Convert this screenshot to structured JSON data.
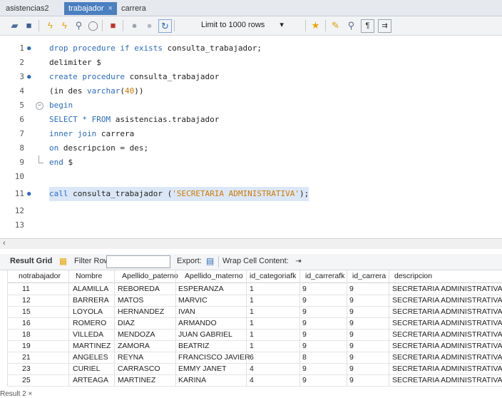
{
  "tabs": [
    {
      "label": "asistencias2",
      "active": false
    },
    {
      "label": "trabajador",
      "active": true,
      "closable": true
    },
    {
      "label": "carrera",
      "active": false
    }
  ],
  "toolbar": {
    "limit_label": "Limit to 1000 rows",
    "icons": [
      "folder-icon",
      "save-icon",
      "lightning-icon",
      "lightning-cursor-icon",
      "magnifier-icon",
      "stop-icon",
      "toggle-output-icon",
      "commit-icon",
      "rollback-icon",
      "autocommit-icon",
      "star-icon",
      "brush-icon",
      "search-icon",
      "invisible-chars-icon",
      "wrap-icon"
    ]
  },
  "editor": {
    "lines": [
      {
        "n": "1",
        "marker": true
      },
      {
        "n": "2"
      },
      {
        "n": "3",
        "marker": true
      },
      {
        "n": "4"
      },
      {
        "n": "5",
        "fold": true
      },
      {
        "n": "6"
      },
      {
        "n": "7"
      },
      {
        "n": "8"
      },
      {
        "n": "9",
        "foldend": true
      },
      {
        "n": "10"
      },
      {
        "n": "11",
        "marker": true
      },
      {
        "n": "12"
      },
      {
        "n": "13"
      }
    ],
    "code": {
      "l1": [
        "drop procedure if exists",
        " consulta_trabajador;"
      ],
      "l2": "delimiter $",
      "l3": [
        "create procedure",
        " consulta_trabajador"
      ],
      "l4": [
        "(in des ",
        "varchar",
        "(",
        "40",
        "))"
      ],
      "l5": "begin",
      "l6": [
        "SELECT * FROM",
        " asistencias.trabajador"
      ],
      "l7": [
        "inner join",
        " carrera"
      ],
      "l8": [
        "on",
        " descripcion = des;"
      ],
      "l9": [
        "end",
        " $"
      ],
      "l11": [
        "call",
        " consulta_trabajador (",
        "'SECRETARIA ADMINISTRATIVA'",
        ");"
      ]
    }
  },
  "result": {
    "grid_label": "Result Grid",
    "filter_label": "Filter Rows:",
    "export_label": "Export:",
    "wrap_label": "Wrap Cell Content:",
    "columns": [
      "notrabajador",
      "Nombre",
      "Apellido_paterno",
      "Apellido_materno",
      "id_categoriafk",
      "id_carrerafk",
      "id_carrera",
      "descripcion"
    ],
    "rows": [
      [
        "11",
        "ALAMILLA",
        "REBOREDA",
        "ESPERANZA",
        "1",
        "9",
        "9",
        "SECRETARIA ADMINISTRATIVA"
      ],
      [
        "12",
        "BARRERA",
        "MATOS",
        "MARVIC",
        "1",
        "9",
        "9",
        "SECRETARIA ADMINISTRATIVA"
      ],
      [
        "15",
        "LOYOLA",
        "HERNANDEZ",
        "IVAN",
        "1",
        "9",
        "9",
        "SECRETARIA ADMINISTRATIVA"
      ],
      [
        "16",
        "ROMERO",
        "DIAZ",
        "ARMANDO",
        "1",
        "9",
        "9",
        "SECRETARIA ADMINISTRATIVA"
      ],
      [
        "18",
        "VILLEDA",
        "MENDOZA",
        "JUAN GABRIEL",
        "1",
        "9",
        "9",
        "SECRETARIA ADMINISTRATIVA"
      ],
      [
        "19",
        "MARTINEZ",
        "ZAMORA",
        "BEATRIZ",
        "1",
        "9",
        "9",
        "SECRETARIA ADMINISTRATIVA"
      ],
      [
        "21",
        "ANGELES",
        "REYNA",
        "FRANCISCO JAVIER",
        "6",
        "8",
        "9",
        "SECRETARIA ADMINISTRATIVA"
      ],
      [
        "23",
        "CURIEL",
        "CARRASCO",
        "EMMY JANET",
        "4",
        "9",
        "9",
        "SECRETARIA ADMINISTRATIVA"
      ],
      [
        "25",
        "ARTEAGA",
        "MARTINEZ",
        "KARINA",
        "4",
        "9",
        "9",
        "SECRETARIA ADMINISTRATIVA"
      ]
    ],
    "bottom_tab": "Result 2"
  }
}
